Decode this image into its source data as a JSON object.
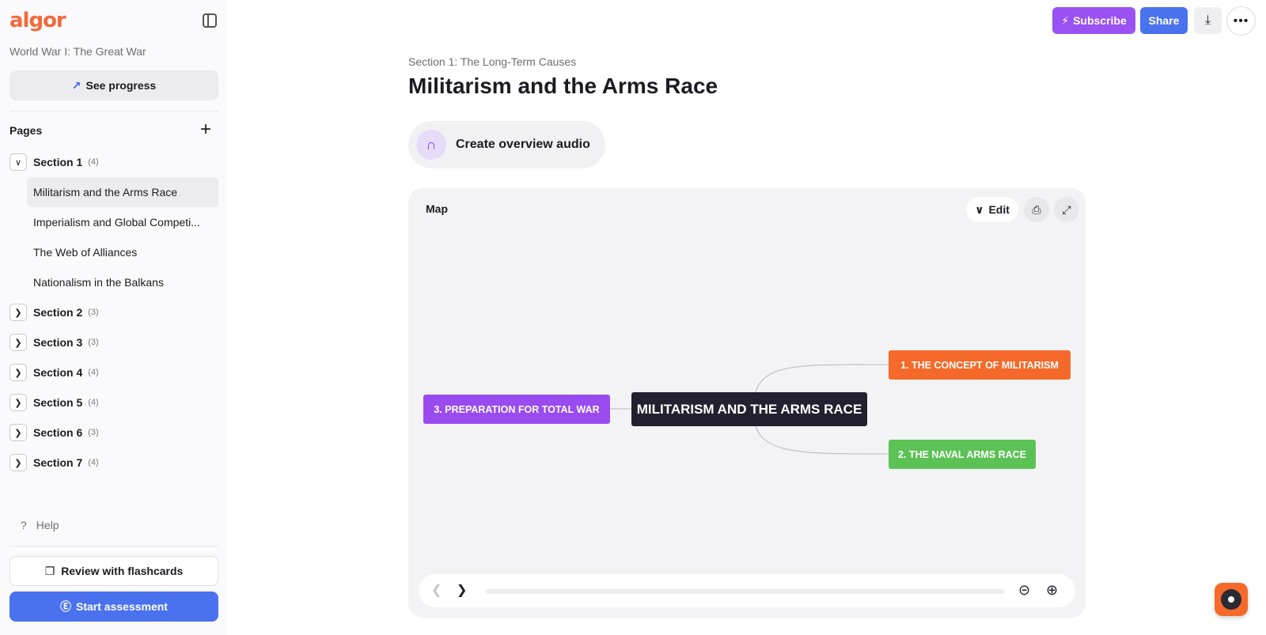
{
  "app": {
    "logo": "algor"
  },
  "sidebar": {
    "course_title": "World War I: The Great War",
    "progress_label": "See progress",
    "pages_label": "Pages",
    "sections": [
      {
        "name": "Section 1",
        "count": "(4)",
        "expanded": true,
        "pages": [
          "Militarism and the Arms Race",
          "Imperialism and Global Competi...",
          "The Web of Alliances",
          "Nationalism in the Balkans"
        ]
      },
      {
        "name": "Section 2",
        "count": "(3)"
      },
      {
        "name": "Section 3",
        "count": "(3)"
      },
      {
        "name": "Section 4",
        "count": "(4)"
      },
      {
        "name": "Section 5",
        "count": "(4)"
      },
      {
        "name": "Section 6",
        "count": "(3)"
      },
      {
        "name": "Section 7",
        "count": "(4)"
      }
    ],
    "help_label": "Help",
    "flashcards_label": "Review with flashcards",
    "assessment_label": "Start assessment"
  },
  "toolbar": {
    "subscribe_label": "Subscribe",
    "share_label": "Share"
  },
  "main": {
    "breadcrumb": "Section 1: The Long-Term Causes",
    "title": "Militarism and the Arms Race",
    "audio_label": "Create overview audio"
  },
  "map": {
    "label": "Map",
    "edit_label": "Edit",
    "center": "MILITARISM AND THE ARMS RACE",
    "node1": "1. THE CONCEPT OF MILITARISM",
    "node2": "2. THE NAVAL ARMS RACE",
    "node3": "3. PREPARATION FOR TOTAL WAR",
    "colors": {
      "center": "#232130",
      "node1": "#f56a2a",
      "node2": "#5cc256",
      "node3": "#9a4bf0"
    }
  }
}
